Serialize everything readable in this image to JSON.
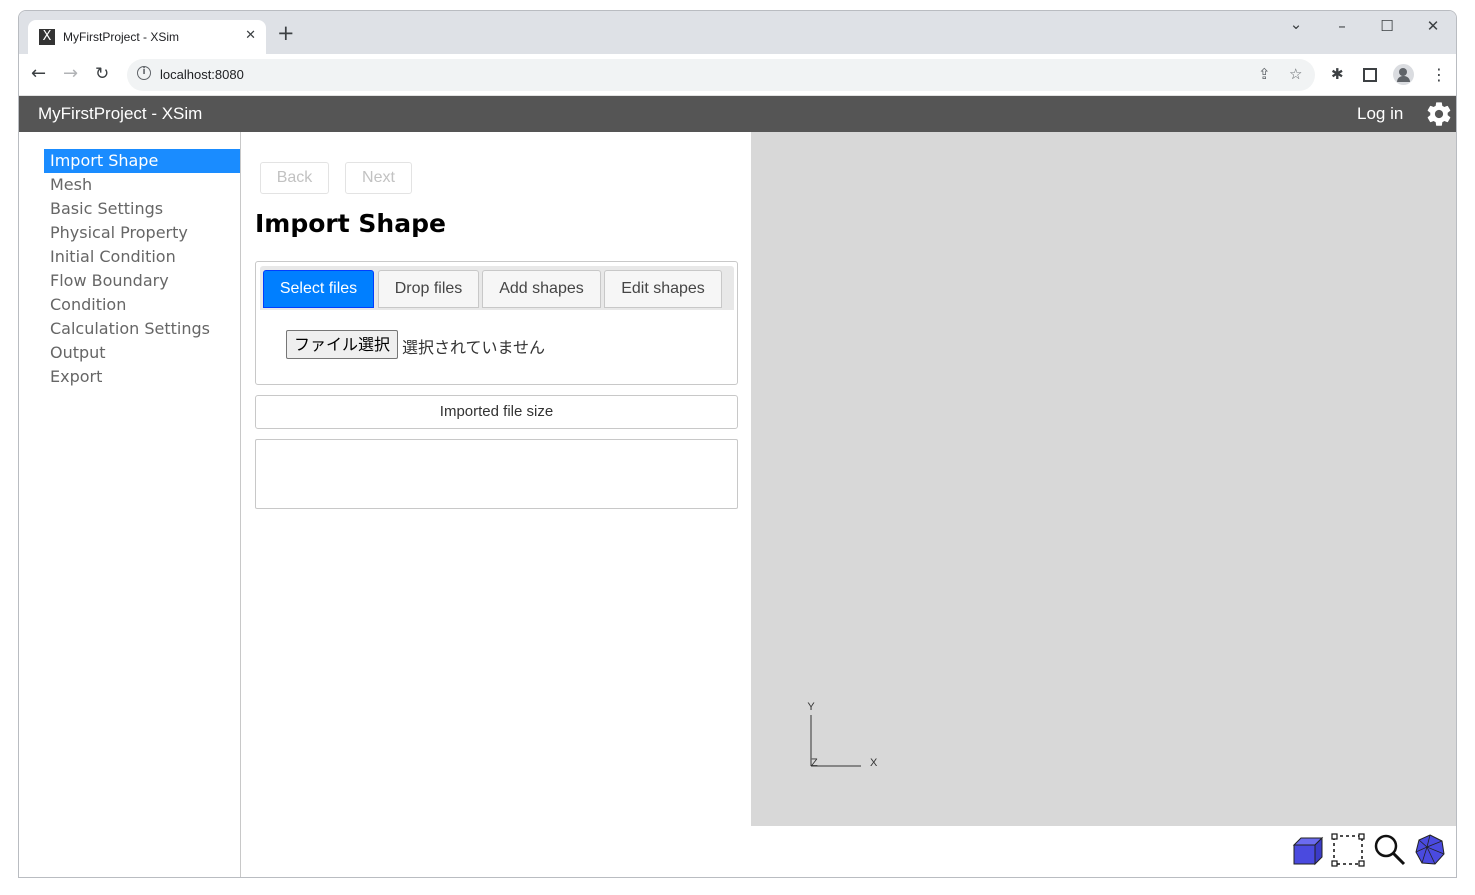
{
  "browser": {
    "tab_title": "MyFirstProject - XSim",
    "tab_favicon": "X",
    "close_tab": "✕",
    "new_tab": "+",
    "url": "localhost:8080",
    "window_controls": {
      "minimize": "–",
      "maximize": "☐",
      "close": "✕",
      "tab_search": "⌄"
    }
  },
  "app": {
    "title": "MyFirstProject - XSim",
    "login_label": "Log in",
    "settings_icon": "gear-icon"
  },
  "sidebar": {
    "items": [
      {
        "label": "Import Shape",
        "active": true
      },
      {
        "label": "Mesh"
      },
      {
        "label": "Basic Settings"
      },
      {
        "label": "Physical Property"
      },
      {
        "label": "Initial Condition"
      },
      {
        "label": "Flow Boundary"
      },
      {
        "label": "Condition"
      },
      {
        "label": "Calculation Settings"
      },
      {
        "label": "Output"
      },
      {
        "label": "Export"
      }
    ]
  },
  "panel": {
    "back_label": "Back",
    "next_label": "Next",
    "title": "Import Shape",
    "tabs": [
      {
        "label": "Select files",
        "active": true
      },
      {
        "label": "Drop files"
      },
      {
        "label": "Add shapes"
      },
      {
        "label": "Edit shapes"
      }
    ],
    "file_button_label": "ファイル選択",
    "file_status": "選択されていません",
    "imported_file_size_label": "Imported file size"
  },
  "viewport": {
    "background": "#d8d8d8",
    "axis_labels": {
      "x": "X",
      "y": "Y",
      "z": "Z"
    },
    "tools": [
      "box-view-icon",
      "selection-box-icon",
      "zoom-icon",
      "polyhedron-view-icon"
    ]
  },
  "colors": {
    "accent": "#1a8cff",
    "tab_active": "#007fff",
    "appbar": "#555555",
    "tool_blue": "#4a4adf"
  }
}
